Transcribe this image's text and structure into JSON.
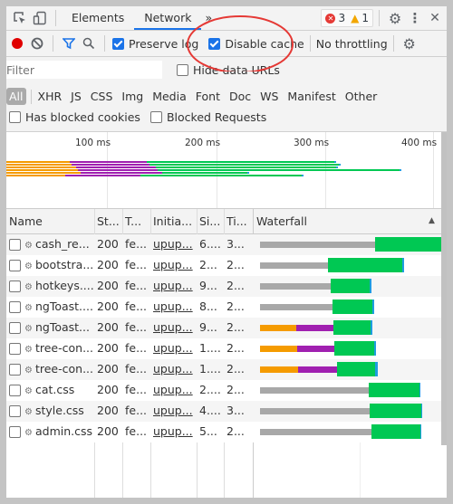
{
  "tabbar": {
    "inspect_icon": "element-picker-icon",
    "device_icon": "device-toggle-icon",
    "tabs": [
      {
        "label": "Elements",
        "active": false
      },
      {
        "label": "Network",
        "active": true
      }
    ],
    "more_tabs": "»",
    "errors": "3",
    "warnings": "1",
    "settings_icon": "gear-icon",
    "menu_icon": "kebab-menu-icon",
    "close_icon": "close-icon"
  },
  "toolbar": {
    "record_icon": "record-icon",
    "clear_icon": "clear-icon",
    "filter_icon": "funnel-icon",
    "search_icon": "search-icon",
    "preserve_log": {
      "label": "Preserve log",
      "checked": true
    },
    "disable_cache": {
      "label": "Disable cache",
      "checked": true
    },
    "throttling": "No throttling",
    "settings_icon": "gear-icon"
  },
  "filterbar": {
    "filter_placeholder": "Filter",
    "hide_data_urls": {
      "label": "Hide data URLs",
      "checked": false
    },
    "types": [
      "All",
      "XHR",
      "JS",
      "CSS",
      "Img",
      "Media",
      "Font",
      "Doc",
      "WS",
      "Manifest",
      "Other"
    ],
    "active_type": "All",
    "has_blocked_cookies": {
      "label": "Has blocked cookies",
      "checked": false
    },
    "blocked_requests": {
      "label": "Blocked Requests",
      "checked": false
    }
  },
  "overview": {
    "ticks": [
      "100 ms",
      "200 ms",
      "300 ms",
      "400 ms"
    ]
  },
  "table": {
    "columns": [
      "Name",
      "St...",
      "T...",
      "Initia...",
      "Si...",
      "Ti...",
      "Waterfall"
    ],
    "sort_icon": "sort-ascending-icon",
    "rows": [
      {
        "name": "cash_re...",
        "status": "200",
        "type": "fe...",
        "initiator": "upup...",
        "size": "6....",
        "time": "3..."
      },
      {
        "name": "bootstra...",
        "status": "200",
        "type": "fe...",
        "initiator": "upup...",
        "size": "2...",
        "time": "2..."
      },
      {
        "name": "hotkeys....",
        "status": "200",
        "type": "fe...",
        "initiator": "upup...",
        "size": "9...",
        "time": "2..."
      },
      {
        "name": "ngToast....",
        "status": "200",
        "type": "fe...",
        "initiator": "upup...",
        "size": "8...",
        "time": "2..."
      },
      {
        "name": "ngToast...",
        "status": "200",
        "type": "fe...",
        "initiator": "upup...",
        "size": "9...",
        "time": "2..."
      },
      {
        "name": "tree-con...",
        "status": "200",
        "type": "fe...",
        "initiator": "upup...",
        "size": "1....",
        "time": "2..."
      },
      {
        "name": "tree-con...",
        "status": "200",
        "type": "fe...",
        "initiator": "upup...",
        "size": "1....",
        "time": "2..."
      },
      {
        "name": "cat.css",
        "status": "200",
        "type": "fe...",
        "initiator": "upup...",
        "size": "2....",
        "time": "2..."
      },
      {
        "name": "style.css",
        "status": "200",
        "type": "fe...",
        "initiator": "upup...",
        "size": "4....",
        "time": "3..."
      },
      {
        "name": "admin.css",
        "status": "200",
        "type": "fe...",
        "initiator": "upup...",
        "size": "5...",
        "time": "2..."
      }
    ]
  },
  "colors": {
    "queue": "#a8a8a8",
    "stalled": "#f59b00",
    "dns": "#a020b0",
    "waiting": "#00c853",
    "download": "#1e9de0",
    "accent": "#1a73e8",
    "annotation": "#e53935"
  }
}
